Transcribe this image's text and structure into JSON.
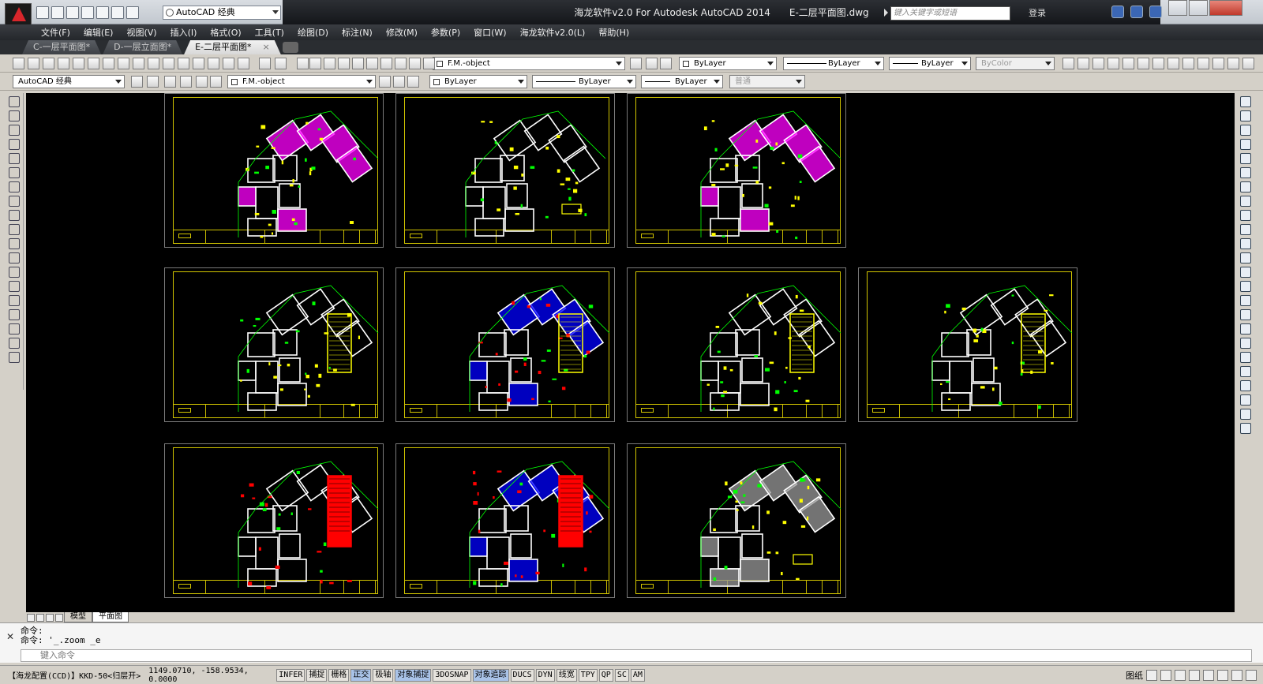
{
  "app": {
    "title_software": "海龙软件v2.0 For Autodesk AutoCAD 2014",
    "title_file": "E-二层平面图.dwg",
    "workspace": "AutoCAD 经典",
    "search_placeholder": "键入关键字或短语",
    "login_label": "登录"
  },
  "menu": [
    "文件(F)",
    "编辑(E)",
    "视图(V)",
    "插入(I)",
    "格式(O)",
    "工具(T)",
    "绘图(D)",
    "标注(N)",
    "修改(M)",
    "参数(P)",
    "窗口(W)",
    "海龙软件v2.0(L)",
    "帮助(H)"
  ],
  "doc_tabs": [
    {
      "label": "C-一层平面图*",
      "active": false
    },
    {
      "label": "D-一层立面图*",
      "active": false
    },
    {
      "label": "E-二层平面图*",
      "active": true
    }
  ],
  "toolbar1": {
    "layer": "F.M.-object",
    "color": "ByLayer",
    "linetype": "ByLayer",
    "lineweight": "ByLayer",
    "plotstyle": "ByColor"
  },
  "toolbar2": {
    "workspace": "AutoCAD 经典",
    "layer": "F.M.-object",
    "color": "ByLayer",
    "linetype": "ByLayer",
    "lineweight": "ByLayer",
    "style": "普通"
  },
  "colors": {
    "canvas": "#000000",
    "frame": "#d2c500",
    "wall": "#ffffff",
    "magenta": "#ff00ff",
    "yellow": "#ffff00",
    "blue": "#0000ff",
    "red": "#ff0000",
    "green": "#00ff00",
    "gray": "#9a9a9a"
  },
  "sheets": [
    {
      "fill": "magenta",
      "table": "none"
    },
    {
      "fill": "none",
      "table": "small"
    },
    {
      "fill": "magenta-yellow",
      "table": "none"
    },
    {
      "fill": "yellow",
      "table": "yellow"
    },
    {
      "fill": "blue",
      "table": "yellow"
    },
    {
      "fill": "yellow",
      "table": "yellow"
    },
    {
      "fill": "yellow",
      "table": "yellow"
    },
    {
      "fill": "red",
      "table": "red"
    },
    {
      "fill": "blue",
      "table": "red"
    },
    {
      "fill": "gray",
      "table": "small"
    }
  ],
  "layout_tabs": [
    {
      "label": "模型",
      "active": false
    },
    {
      "label": "平面图",
      "active": true
    }
  ],
  "command": {
    "line1": "命令:",
    "line2": "命令: '_.zoom _e",
    "input_placeholder": "键入命令"
  },
  "status": {
    "left": "【海龙配置(CCD)】KKD-50<归层开>",
    "coords": "1149.0710, -158.9534, 0.0000",
    "buttons": [
      {
        "label": "INFER",
        "on": false
      },
      {
        "label": "捕捉",
        "on": false
      },
      {
        "label": "栅格",
        "on": false
      },
      {
        "label": "正交",
        "on": true
      },
      {
        "label": "极轴",
        "on": false
      },
      {
        "label": "对象捕捉",
        "on": true
      },
      {
        "label": "3DOSNAP",
        "on": false
      },
      {
        "label": "对象追踪",
        "on": true
      },
      {
        "label": "DUCS",
        "on": false
      },
      {
        "label": "DYN",
        "on": false
      },
      {
        "label": "线宽",
        "on": false
      },
      {
        "label": "TPY",
        "on": false
      },
      {
        "label": "QP",
        "on": false
      },
      {
        "label": "SC",
        "on": false
      },
      {
        "label": "AM",
        "on": false
      }
    ],
    "paper_label": "图纸"
  }
}
